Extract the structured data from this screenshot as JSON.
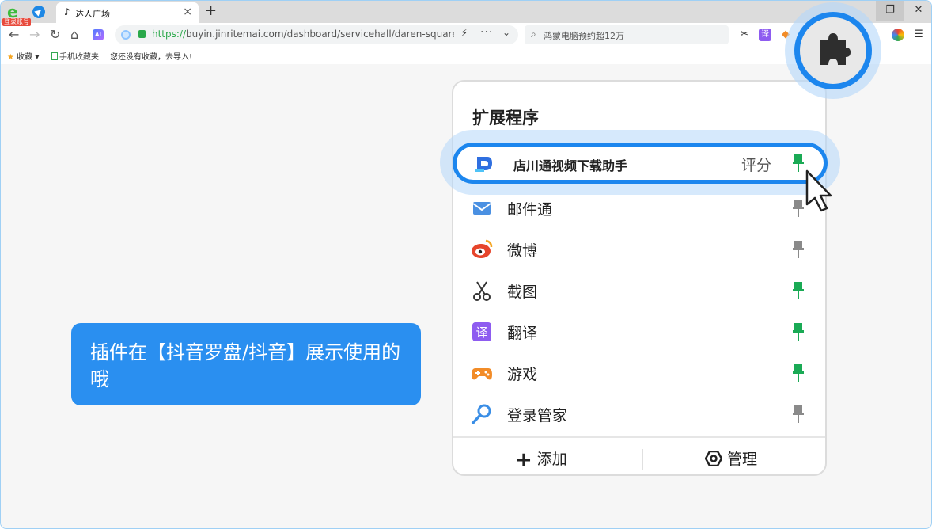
{
  "browser": {
    "app_badge": "登录账号",
    "tab": {
      "title": "达人广场",
      "favicon": "tiktok-icon"
    },
    "url": {
      "protocol": "https://",
      "rest": "buyin.jinritemai.com/dashboard/servicehall/daren-square?pre"
    },
    "search_text": "鸿蒙电脑预约超12万",
    "bookmarks": {
      "favorites": "收藏",
      "mobile": "手机收藏夹",
      "hint": "您还没有收藏，去导入!"
    },
    "ai_label": "AI"
  },
  "callout": {
    "text": "插件在【抖音罗盘/抖音】展示使用的哦"
  },
  "extensions_panel": {
    "title": "扩展程序",
    "highlighted": {
      "name": "店川通视频下载助手",
      "rate_label": "评分",
      "pinned": true,
      "icon": "download-helper-icon"
    },
    "items": [
      {
        "name": "邮件通",
        "pinned": false,
        "icon": "mail-icon"
      },
      {
        "name": "微博",
        "pinned": false,
        "icon": "weibo-icon"
      },
      {
        "name": "截图",
        "pinned": true,
        "icon": "scissors-icon"
      },
      {
        "name": "翻译",
        "pinned": true,
        "icon": "translate-icon"
      },
      {
        "name": "游戏",
        "pinned": true,
        "icon": "gamepad-icon"
      },
      {
        "name": "登录管家",
        "pinned": false,
        "icon": "key-icon"
      }
    ],
    "add_label": "添加",
    "manage_label": "管理"
  },
  "colors": {
    "accent": "#1c86ee",
    "pin_active": "#1aaa55",
    "pin_inactive": "#8a8a8a",
    "callout": "#2a8ff0"
  }
}
